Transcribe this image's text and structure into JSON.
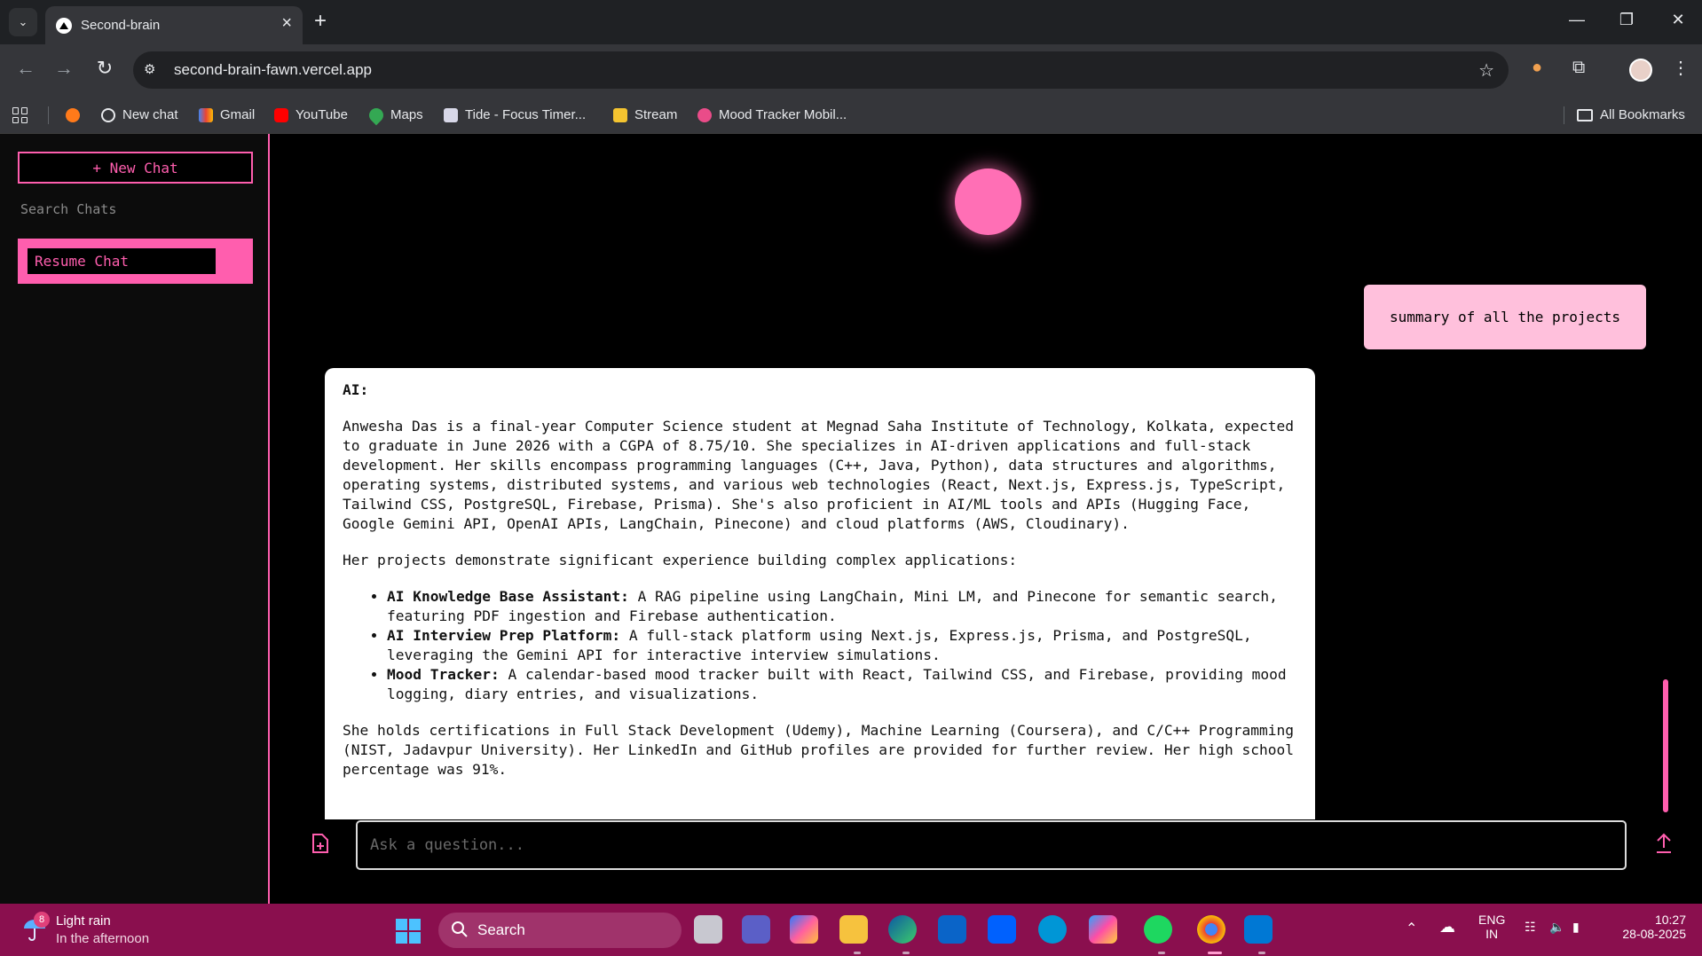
{
  "browser": {
    "tab_title": "Second-brain",
    "url": "second-brain-fawn.vercel.app",
    "bookmarks": [
      {
        "label": "New chat",
        "icon": "openai-icon"
      },
      {
        "label": "Gmail",
        "icon": "gmail-icon"
      },
      {
        "label": "YouTube",
        "icon": "youtube-icon"
      },
      {
        "label": "Maps",
        "icon": "maps-icon"
      },
      {
        "label": "Tide - Focus Timer...",
        "icon": "tide-icon"
      },
      {
        "label": "Stream",
        "icon": "stream-icon"
      },
      {
        "label": "Mood Tracker Mobil...",
        "icon": "dribbble-icon"
      }
    ],
    "all_bookmarks": "All Bookmarks"
  },
  "sidebar": {
    "new_chat_label": "+ New Chat",
    "search_label": "Search Chats",
    "chats": [
      {
        "label": "Resume Chat"
      }
    ]
  },
  "chat": {
    "user_message": "summary of all the projects",
    "ai_label": "AI:",
    "ai_para1": "Anwesha Das is a final-year Computer Science student at Megnad Saha Institute of Technology, Kolkata, expected to graduate in June 2026 with a CGPA of 8.75/10. She specializes in AI-driven applications and full-stack development. Her skills encompass programming languages (C++, Java, Python), data structures and algorithms, operating systems, distributed systems, and various web technologies (React, Next.js, Express.js, TypeScript, Tailwind CSS, PostgreSQL, Firebase, Prisma). She's also proficient in AI/ML tools and APIs (Hugging Face, Google Gemini API, OpenAI APIs, LangChain, Pinecone) and cloud platforms (AWS, Cloudinary).",
    "ai_para2": "Her projects demonstrate significant experience building complex applications:",
    "projects": [
      {
        "title": "AI Knowledge Base Assistant:",
        "desc": " A RAG pipeline using LangChain, Mini LM, and Pinecone for semantic search, featuring PDF ingestion and Firebase authentication."
      },
      {
        "title": "AI Interview Prep Platform:",
        "desc": " A full-stack platform using Next.js, Express.js, Prisma, and PostgreSQL, leveraging the Gemini API for interactive interview simulations."
      },
      {
        "title": "Mood Tracker:",
        "desc": " A calendar-based mood tracker built with React, Tailwind CSS, and Firebase, providing mood logging, diary entries, and visualizations."
      }
    ],
    "ai_para3": "She holds certifications in Full Stack Development (Udemy), Machine Learning (Coursera), and C/C++ Programming (NIST, Jadavpur University). Her LinkedIn and GitHub profiles are provided for further review. Her high school percentage was 91%.",
    "input_placeholder": "Ask a question..."
  },
  "taskbar": {
    "weather_badge": "8",
    "weather_title": "Light rain",
    "weather_sub": "In the afternoon",
    "search_label": "Search",
    "lang1": "ENG",
    "lang2": "IN",
    "time": "10:27",
    "date": "28-08-2025"
  },
  "colors": {
    "accent": "#ff5eae",
    "user_bubble": "#ffc0dc",
    "taskbar": "#8a0f4e"
  }
}
